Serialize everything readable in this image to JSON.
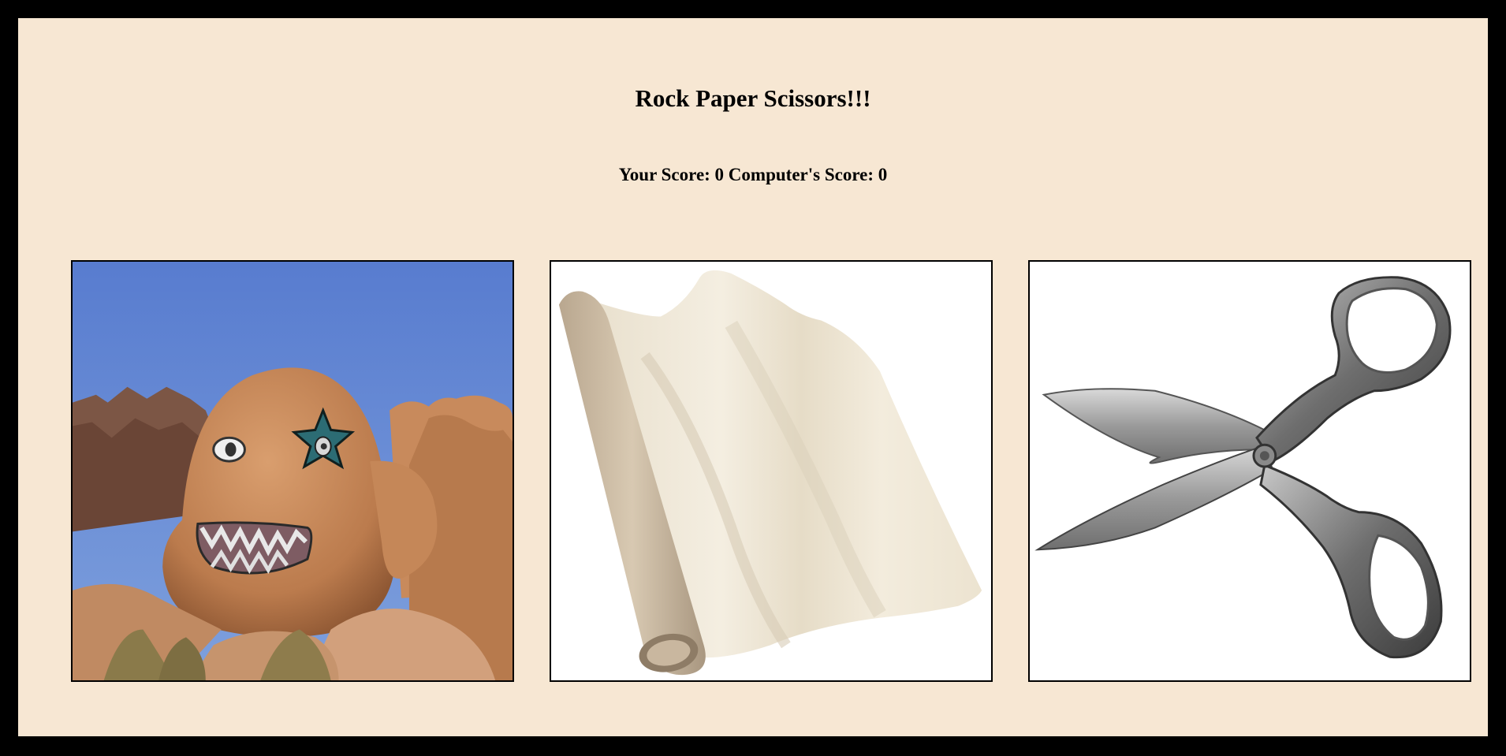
{
  "game": {
    "title": "Rock Paper Scissors!!!",
    "score_text": "Your Score: 0 Computer's Score: 0",
    "player_score": 0,
    "computer_score": 0
  },
  "choices": [
    {
      "id": "rock",
      "icon": "rock-face-image"
    },
    {
      "id": "paper",
      "icon": "paper-roll-image"
    },
    {
      "id": "scissors",
      "icon": "scissors-image"
    }
  ],
  "colors": {
    "background": "#f7e7d3",
    "frame": "#000000",
    "sky": "#5b7fd0",
    "rock": "#c98c5d",
    "paper": "#ebe3d2",
    "steel": "#8a8a8a"
  }
}
